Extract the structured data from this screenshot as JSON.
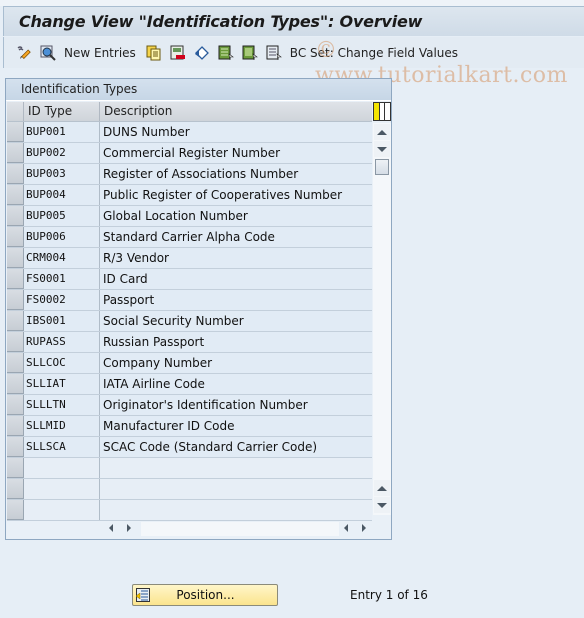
{
  "window": {
    "title": "Change View \"Identification Types\": Overview",
    "watermark": "© www.tutorialkart.com"
  },
  "toolbar": {
    "items": [
      {
        "type": "icon",
        "icon": "change-display-icon"
      },
      {
        "type": "icon",
        "icon": "details-icon"
      },
      {
        "type": "text",
        "label": "New Entries"
      },
      {
        "type": "icon",
        "icon": "copy-as-icon"
      },
      {
        "type": "icon",
        "icon": "delete-icon"
      },
      {
        "type": "icon",
        "icon": "undo-change-icon"
      },
      {
        "type": "icon",
        "icon": "select-all-icon"
      },
      {
        "type": "icon",
        "icon": "select-block-icon"
      },
      {
        "type": "icon",
        "icon": "deselect-all-icon"
      },
      {
        "type": "text",
        "label": "BC Set: Change Field Values"
      }
    ],
    "new_entries_label": "New Entries",
    "bc_set_label": "BC Set: Change Field Values"
  },
  "table": {
    "title": "Identification Types",
    "columns": [
      "ID Type",
      "Description"
    ],
    "rows": [
      {
        "id": "BUP001",
        "desc": "DUNS Number"
      },
      {
        "id": "BUP002",
        "desc": "Commercial Register Number"
      },
      {
        "id": "BUP003",
        "desc": "Register of Associations Number"
      },
      {
        "id": "BUP004",
        "desc": "Public Register of Cooperatives Number"
      },
      {
        "id": "BUP005",
        "desc": "Global Location Number"
      },
      {
        "id": "BUP006",
        "desc": "Standard Carrier Alpha Code"
      },
      {
        "id": "CRM004",
        "desc": "R/3 Vendor"
      },
      {
        "id": "FS0001",
        "desc": "ID Card"
      },
      {
        "id": "FS0002",
        "desc": "Passport"
      },
      {
        "id": "IBS001",
        "desc": "Social Security Number"
      },
      {
        "id": "RUPASS",
        "desc": "Russian Passport"
      },
      {
        "id": "SLLCOC",
        "desc": "Company Number"
      },
      {
        "id": "SLLIAT",
        "desc": "IATA Airline Code"
      },
      {
        "id": "SLLLTN",
        "desc": "Originator's Identification Number"
      },
      {
        "id": "SLLMID",
        "desc": "Manufacturer ID Code"
      },
      {
        "id": "SLLSCA",
        "desc": "SCAC Code (Standard Carrier Code)"
      }
    ],
    "empty_rows": 3
  },
  "footer": {
    "position_label": "Position...",
    "entry_info": "Entry 1 of 16"
  },
  "colors": {
    "title_bg": "#d4dfea",
    "position_button": "#fbe48d",
    "watermark": "#d69664"
  }
}
